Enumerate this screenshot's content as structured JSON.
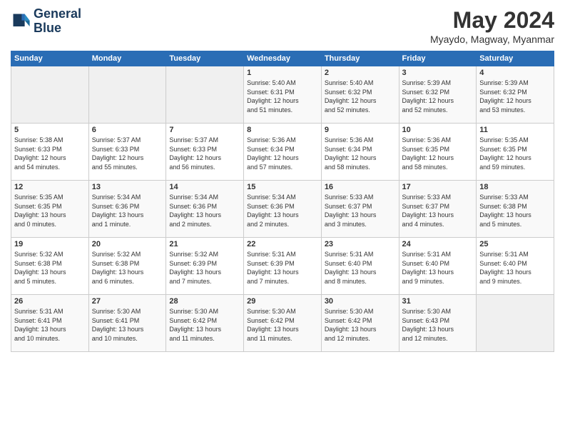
{
  "logo": {
    "line1": "General",
    "line2": "Blue"
  },
  "title": "May 2024",
  "location": "Myaydo, Magway, Myanmar",
  "days_header": [
    "Sunday",
    "Monday",
    "Tuesday",
    "Wednesday",
    "Thursday",
    "Friday",
    "Saturday"
  ],
  "weeks": [
    [
      {
        "day": "",
        "info": ""
      },
      {
        "day": "",
        "info": ""
      },
      {
        "day": "",
        "info": ""
      },
      {
        "day": "1",
        "info": "Sunrise: 5:40 AM\nSunset: 6:31 PM\nDaylight: 12 hours\nand 51 minutes."
      },
      {
        "day": "2",
        "info": "Sunrise: 5:40 AM\nSunset: 6:32 PM\nDaylight: 12 hours\nand 52 minutes."
      },
      {
        "day": "3",
        "info": "Sunrise: 5:39 AM\nSunset: 6:32 PM\nDaylight: 12 hours\nand 52 minutes."
      },
      {
        "day": "4",
        "info": "Sunrise: 5:39 AM\nSunset: 6:32 PM\nDaylight: 12 hours\nand 53 minutes."
      }
    ],
    [
      {
        "day": "5",
        "info": "Sunrise: 5:38 AM\nSunset: 6:33 PM\nDaylight: 12 hours\nand 54 minutes."
      },
      {
        "day": "6",
        "info": "Sunrise: 5:37 AM\nSunset: 6:33 PM\nDaylight: 12 hours\nand 55 minutes."
      },
      {
        "day": "7",
        "info": "Sunrise: 5:37 AM\nSunset: 6:33 PM\nDaylight: 12 hours\nand 56 minutes."
      },
      {
        "day": "8",
        "info": "Sunrise: 5:36 AM\nSunset: 6:34 PM\nDaylight: 12 hours\nand 57 minutes."
      },
      {
        "day": "9",
        "info": "Sunrise: 5:36 AM\nSunset: 6:34 PM\nDaylight: 12 hours\nand 58 minutes."
      },
      {
        "day": "10",
        "info": "Sunrise: 5:36 AM\nSunset: 6:35 PM\nDaylight: 12 hours\nand 58 minutes."
      },
      {
        "day": "11",
        "info": "Sunrise: 5:35 AM\nSunset: 6:35 PM\nDaylight: 12 hours\nand 59 minutes."
      }
    ],
    [
      {
        "day": "12",
        "info": "Sunrise: 5:35 AM\nSunset: 6:35 PM\nDaylight: 13 hours\nand 0 minutes."
      },
      {
        "day": "13",
        "info": "Sunrise: 5:34 AM\nSunset: 6:36 PM\nDaylight: 13 hours\nand 1 minute."
      },
      {
        "day": "14",
        "info": "Sunrise: 5:34 AM\nSunset: 6:36 PM\nDaylight: 13 hours\nand 2 minutes."
      },
      {
        "day": "15",
        "info": "Sunrise: 5:34 AM\nSunset: 6:36 PM\nDaylight: 13 hours\nand 2 minutes."
      },
      {
        "day": "16",
        "info": "Sunrise: 5:33 AM\nSunset: 6:37 PM\nDaylight: 13 hours\nand 3 minutes."
      },
      {
        "day": "17",
        "info": "Sunrise: 5:33 AM\nSunset: 6:37 PM\nDaylight: 13 hours\nand 4 minutes."
      },
      {
        "day": "18",
        "info": "Sunrise: 5:33 AM\nSunset: 6:38 PM\nDaylight: 13 hours\nand 5 minutes."
      }
    ],
    [
      {
        "day": "19",
        "info": "Sunrise: 5:32 AM\nSunset: 6:38 PM\nDaylight: 13 hours\nand 5 minutes."
      },
      {
        "day": "20",
        "info": "Sunrise: 5:32 AM\nSunset: 6:38 PM\nDaylight: 13 hours\nand 6 minutes."
      },
      {
        "day": "21",
        "info": "Sunrise: 5:32 AM\nSunset: 6:39 PM\nDaylight: 13 hours\nand 7 minutes."
      },
      {
        "day": "22",
        "info": "Sunrise: 5:31 AM\nSunset: 6:39 PM\nDaylight: 13 hours\nand 7 minutes."
      },
      {
        "day": "23",
        "info": "Sunrise: 5:31 AM\nSunset: 6:40 PM\nDaylight: 13 hours\nand 8 minutes."
      },
      {
        "day": "24",
        "info": "Sunrise: 5:31 AM\nSunset: 6:40 PM\nDaylight: 13 hours\nand 9 minutes."
      },
      {
        "day": "25",
        "info": "Sunrise: 5:31 AM\nSunset: 6:40 PM\nDaylight: 13 hours\nand 9 minutes."
      }
    ],
    [
      {
        "day": "26",
        "info": "Sunrise: 5:31 AM\nSunset: 6:41 PM\nDaylight: 13 hours\nand 10 minutes."
      },
      {
        "day": "27",
        "info": "Sunrise: 5:30 AM\nSunset: 6:41 PM\nDaylight: 13 hours\nand 10 minutes."
      },
      {
        "day": "28",
        "info": "Sunrise: 5:30 AM\nSunset: 6:42 PM\nDaylight: 13 hours\nand 11 minutes."
      },
      {
        "day": "29",
        "info": "Sunrise: 5:30 AM\nSunset: 6:42 PM\nDaylight: 13 hours\nand 11 minutes."
      },
      {
        "day": "30",
        "info": "Sunrise: 5:30 AM\nSunset: 6:42 PM\nDaylight: 13 hours\nand 12 minutes."
      },
      {
        "day": "31",
        "info": "Sunrise: 5:30 AM\nSunset: 6:43 PM\nDaylight: 13 hours\nand 12 minutes."
      },
      {
        "day": "",
        "info": ""
      }
    ]
  ]
}
